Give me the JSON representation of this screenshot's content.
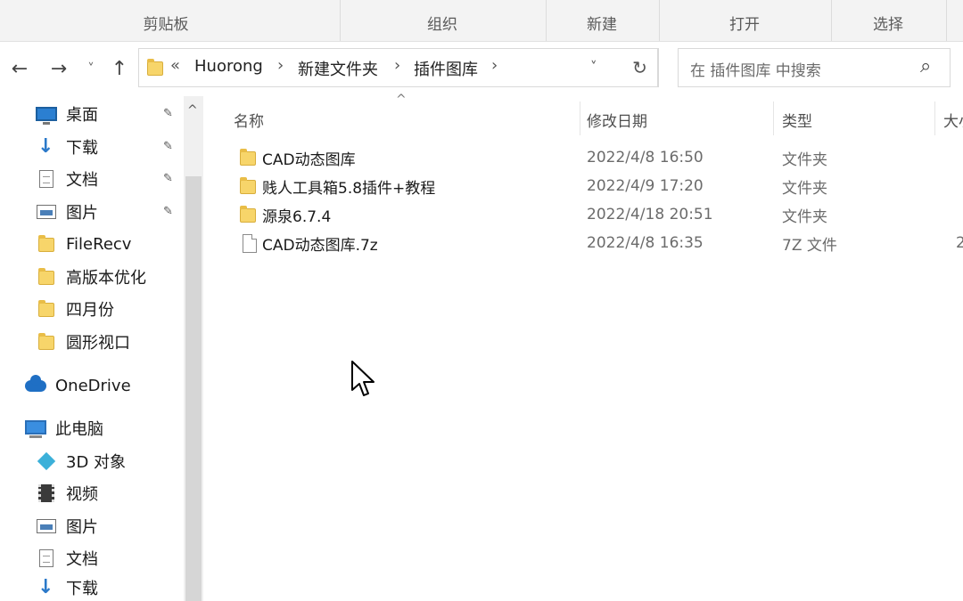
{
  "ribbon": {
    "groups": [
      "剪贴板",
      "组织",
      "新建",
      "打开",
      "选择"
    ]
  },
  "nav": {
    "back_icon": "←",
    "forward_icon": "→",
    "recent_icon": "˅",
    "up_icon": "↑",
    "breadcrumb_overflow": "«",
    "breadcrumbs": [
      "Huorong",
      "新建文件夹",
      "插件图库"
    ],
    "refresh_icon": "↻",
    "dropdown_icon": "˅",
    "search_placeholder": "在 插件图库 中搜索",
    "search_icon": "⌕"
  },
  "sidebar": {
    "quick_access": [
      {
        "label": "桌面",
        "icon": "desktop-icon",
        "pinned": true
      },
      {
        "label": "下载",
        "icon": "download-icon",
        "pinned": true
      },
      {
        "label": "文档",
        "icon": "document-icon",
        "pinned": true
      },
      {
        "label": "图片",
        "icon": "pictures-icon",
        "pinned": true
      },
      {
        "label": "FileRecv",
        "icon": "folder-icon",
        "pinned": false
      },
      {
        "label": "高版本优化",
        "icon": "folder-icon",
        "pinned": false
      },
      {
        "label": "四月份",
        "icon": "folder-icon",
        "pinned": false
      },
      {
        "label": "圆形视口",
        "icon": "folder-icon",
        "pinned": false
      }
    ],
    "onedrive": "OneDrive",
    "this_pc": "此电脑",
    "pc_items": [
      {
        "label": "3D 对象",
        "icon": "3d-objects-icon"
      },
      {
        "label": "视频",
        "icon": "video-icon"
      },
      {
        "label": "图片",
        "icon": "pictures-icon"
      },
      {
        "label": "文档",
        "icon": "document-icon"
      },
      {
        "label": "下载",
        "icon": "download-icon"
      }
    ],
    "pin_icon": "📌",
    "scroll_up_icon": "^"
  },
  "columns": {
    "name": "名称",
    "modified": "修改日期",
    "type": "类型",
    "size": "大小",
    "sort_indicator": "^"
  },
  "files": [
    {
      "name": "CAD动态图库",
      "modified": "2022/4/8 16:50",
      "type": "文件夹",
      "size": "",
      "kind": "folder"
    },
    {
      "name": "贱人工具箱5.8插件+教程",
      "modified": "2022/4/9 17:20",
      "type": "文件夹",
      "size": "",
      "kind": "folder"
    },
    {
      "name": "源泉6.7.4",
      "modified": "2022/4/18 20:51",
      "type": "文件夹",
      "size": "",
      "kind": "folder"
    },
    {
      "name": "CAD动态图库.7z",
      "modified": "2022/4/8 16:35",
      "type": "7Z 文件",
      "size": "2",
      "kind": "file"
    }
  ],
  "colors": {
    "folder": "#f7d56a",
    "accent": "#2b7fd1",
    "ribbon_bg": "#f3f3f3"
  }
}
